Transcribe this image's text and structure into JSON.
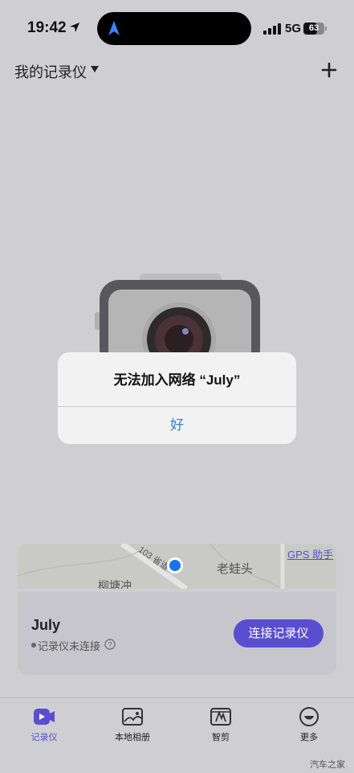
{
  "status_bar": {
    "time": "19:42",
    "network": "5G",
    "battery": "63"
  },
  "header": {
    "title": "我的记录仪",
    "add_icon": "plus-icon",
    "dropdown_icon": "caret-down-icon"
  },
  "alert": {
    "title": "无法加入网络 “July”",
    "ok_label": "好"
  },
  "map": {
    "road_label": "103 省道",
    "place_label_1": "老蛙头",
    "place_label_2": "柳塘冲",
    "gps_link": "GPS 助手"
  },
  "device": {
    "name": "July",
    "status": "记录仪未连接",
    "connect_label": "连接记录仪"
  },
  "tabbar": {
    "tabs": [
      {
        "label": "记录仪",
        "icon": "recorder-icon",
        "active": true
      },
      {
        "label": "本地相册",
        "icon": "album-icon",
        "active": false
      },
      {
        "label": "智剪",
        "icon": "smart-edit-icon",
        "active": false
      },
      {
        "label": "更多",
        "icon": "more-icon",
        "active": false
      }
    ]
  },
  "watermark": "汽车之家",
  "colors": {
    "accent": "#5a4ed0",
    "alert_button": "#2f7fdc",
    "background": "#cfcfd1"
  }
}
